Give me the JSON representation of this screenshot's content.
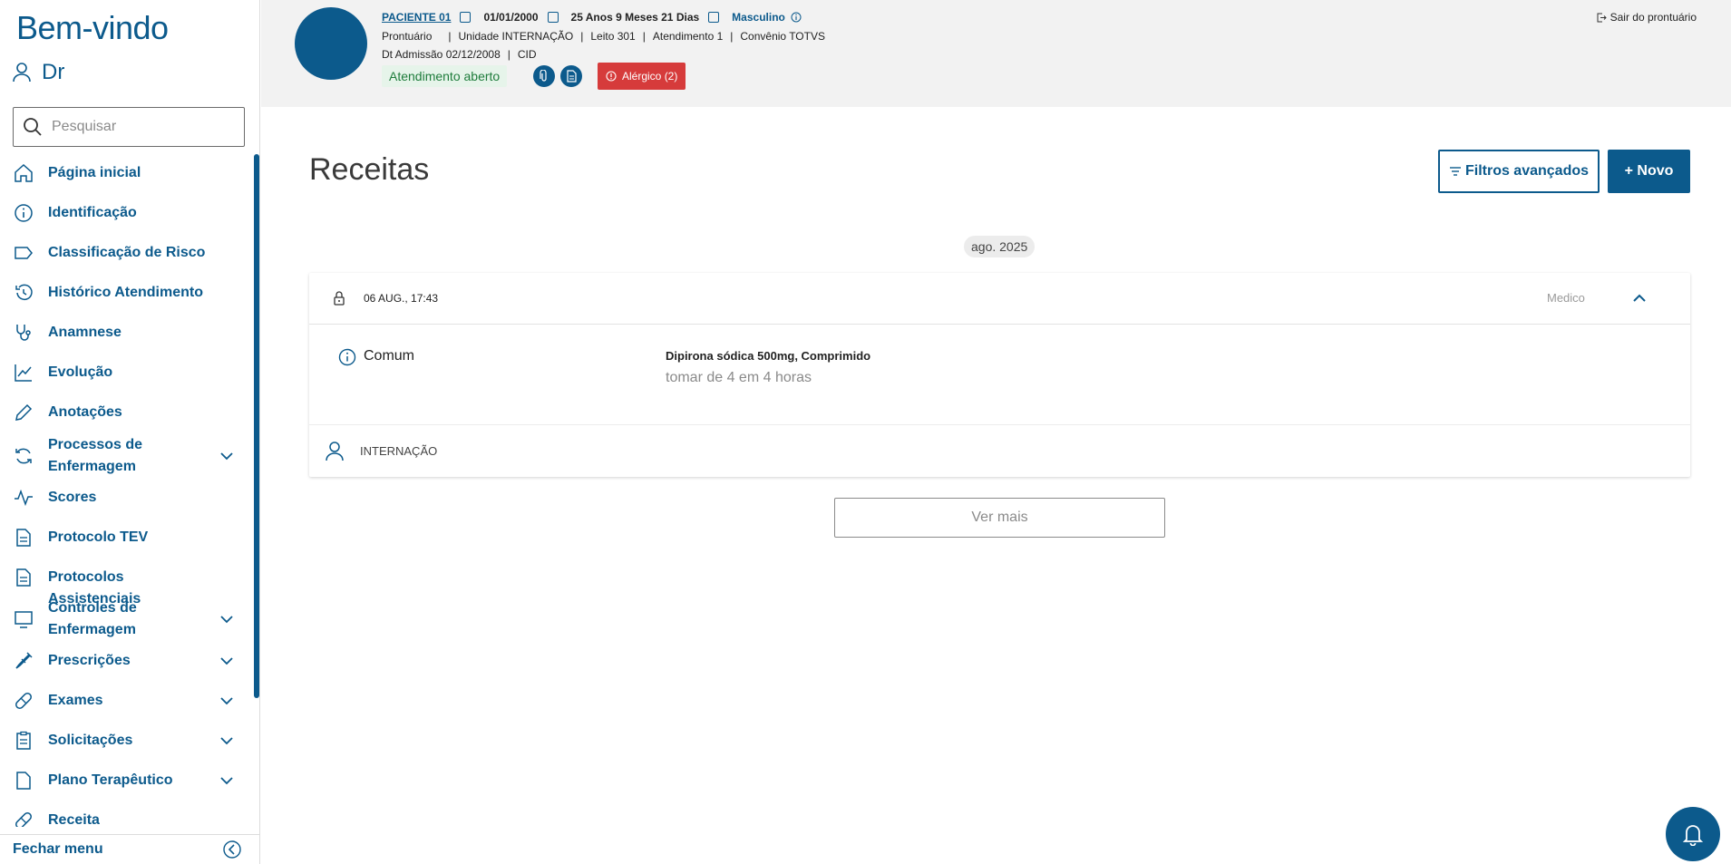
{
  "sidebar": {
    "welcome": "Bem-vindo",
    "user_name": "Dr",
    "search_placeholder": "Pesquisar",
    "items": [
      {
        "label": "Página inicial",
        "icon": "home-icon"
      },
      {
        "label": "Identificação",
        "icon": "info-icon"
      },
      {
        "label": "Classificação de Risco",
        "icon": "tag-icon"
      },
      {
        "label": "Histórico Atendimento",
        "icon": "history-icon"
      },
      {
        "label": "Anamnese",
        "icon": "stethoscope-icon"
      },
      {
        "label": "Evolução",
        "icon": "chart-line-icon"
      },
      {
        "label": "Anotações",
        "icon": "pencil-icon"
      },
      {
        "label": "Processos de Enfermagem",
        "icon": "refresh-icon",
        "expandable": true
      },
      {
        "label": "Scores",
        "icon": "pulse-icon"
      },
      {
        "label": "Protocolo TEV",
        "icon": "document-icon"
      },
      {
        "label": "Protocolos Assistenciais",
        "icon": "document-icon"
      },
      {
        "label": "Controles de Enfermagem",
        "icon": "monitor-icon",
        "expandable": true
      },
      {
        "label": "Prescrições",
        "icon": "syringe-icon",
        "expandable": true
      },
      {
        "label": "Exames",
        "icon": "pill-icon",
        "expandable": true
      },
      {
        "label": "Solicitações",
        "icon": "clipboard-icon",
        "expandable": true
      },
      {
        "label": "Plano Terapêutico",
        "icon": "file-icon",
        "expandable": true
      },
      {
        "label": "Receita",
        "icon": "pill-icon"
      }
    ],
    "close_menu": "Fechar menu"
  },
  "header": {
    "patient_name": "PACIENTE 01",
    "birth_date": "01/01/2000",
    "age": "25 Anos 9 Meses 21 Dias",
    "sex": "Masculino",
    "record": "Prontuário",
    "unit": "Unidade INTERNAÇÃO",
    "bed": "Leito 301",
    "attendance": "Atendimento 1",
    "insurance": "Convênio TOTVS",
    "admission": "Dt Admissão 02/12/2008",
    "cid": "CID",
    "status": "Atendimento aberto",
    "allergy": "Alérgico (2)",
    "logout": "Sair do prontuário"
  },
  "main": {
    "title": "Receitas",
    "filters_button": "Filtros avançados",
    "new_button": "+ Novo",
    "month": "ago. 2025",
    "card": {
      "date": "06 AUG., 17:43",
      "role": "Medico",
      "type": "Comum",
      "drug": "Dipirona sódica 500mg, Comprimido",
      "instructions": "tomar de 4 em 4 horas",
      "unit": "INTERNAÇÃO"
    },
    "more_button": "Ver mais"
  },
  "colors": {
    "primary": "#0c5a8c",
    "danger": "#d63b3b",
    "success_bg": "#e6f4ea"
  }
}
